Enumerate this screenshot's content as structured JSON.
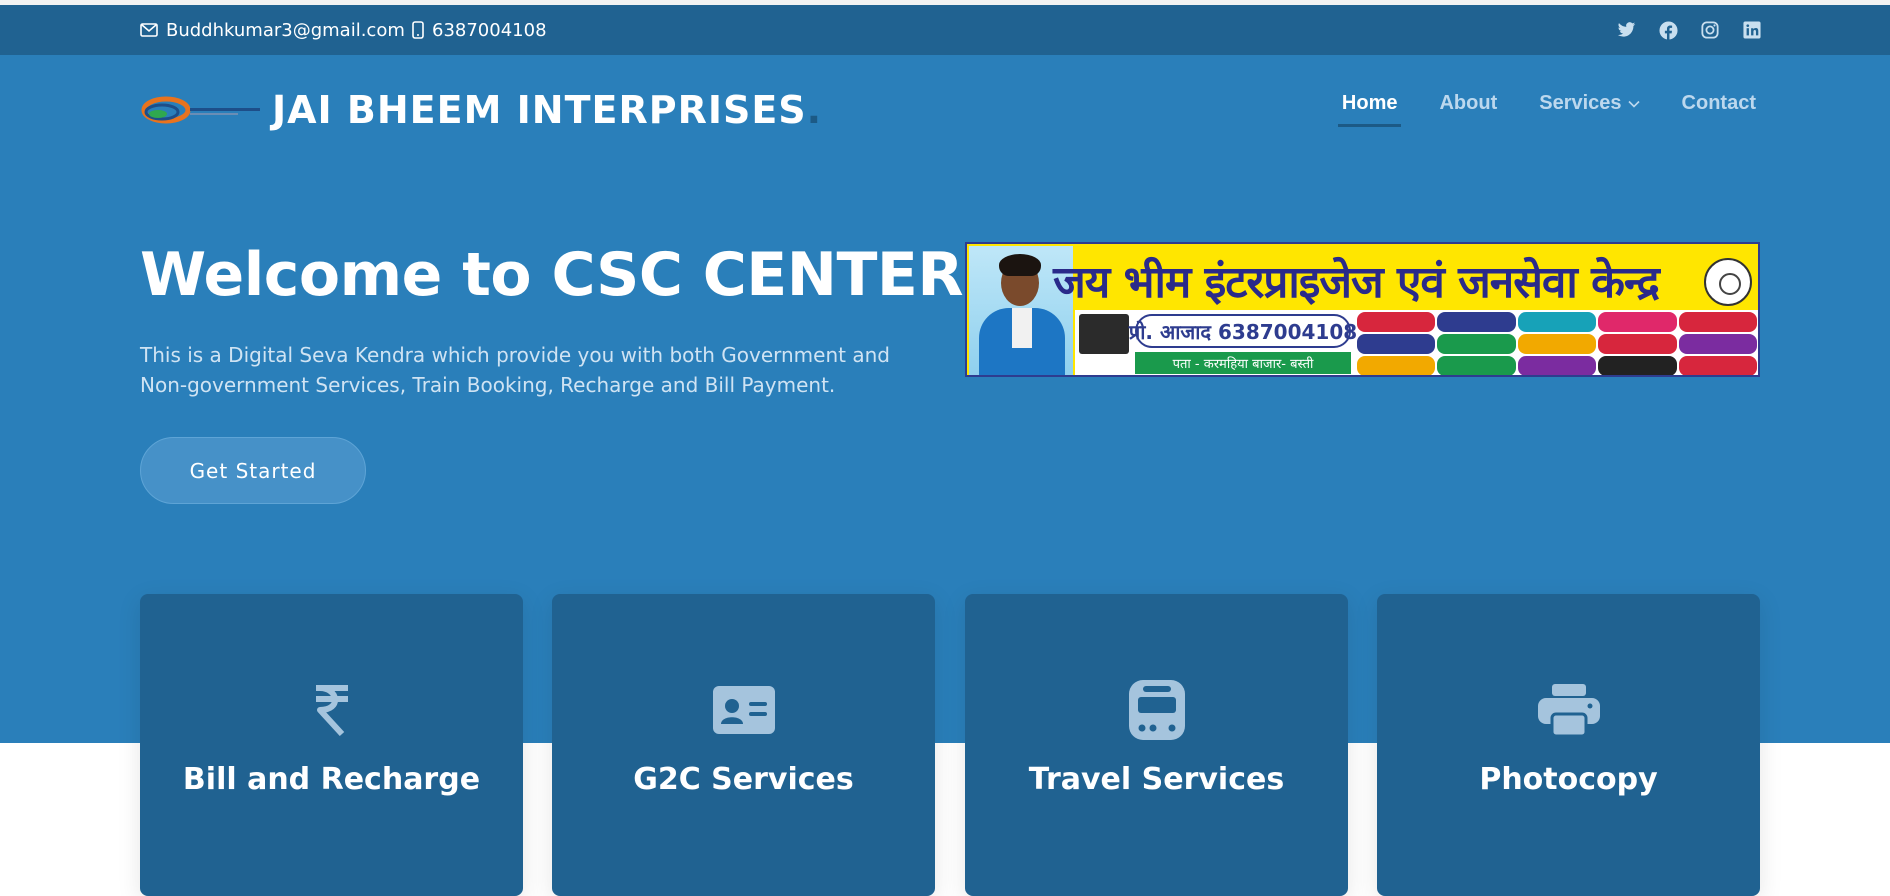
{
  "topbar": {
    "email": "Buddhkumar3@gmail.com",
    "phone": "6387004108",
    "social_icons": [
      "twitter-icon",
      "facebook-icon",
      "instagram-icon",
      "linkedin-icon"
    ]
  },
  "header": {
    "logo_text": "JAI BHEEM INTERPRISES",
    "logo_dot": ".",
    "nav": [
      {
        "label": "Home",
        "active": true
      },
      {
        "label": "About",
        "active": false
      },
      {
        "label": "Services",
        "active": false,
        "has_dropdown": true
      },
      {
        "label": "Contact",
        "active": false
      }
    ]
  },
  "hero": {
    "title": "Welcome to CSC CENTER",
    "description": "This is a Digital Seva Kendra which provide you with both Government and Non-government Services, Train Booking, Recharge and Bill Payment.",
    "cta_label": "Get Started",
    "banner": {
      "title": "जय भीम इंटरप्राइजेज एवं जनसेवा केन्द्र",
      "phone": "प्रो. आजाद 6387004108",
      "address": "पता - करमहिया बाजार- बस्ती"
    }
  },
  "cards": [
    {
      "label": "Bill and Recharge",
      "icon": "rupee-icon"
    },
    {
      "label": "G2C Services",
      "icon": "id-card-icon"
    },
    {
      "label": "Travel Services",
      "icon": "train-icon"
    },
    {
      "label": "Photocopy",
      "icon": "printer-icon"
    }
  ],
  "colors": {
    "topbar": "#206291",
    "hero": "#2a7fba",
    "card": "#206291",
    "nav_inactive": "#bcd8ee"
  }
}
